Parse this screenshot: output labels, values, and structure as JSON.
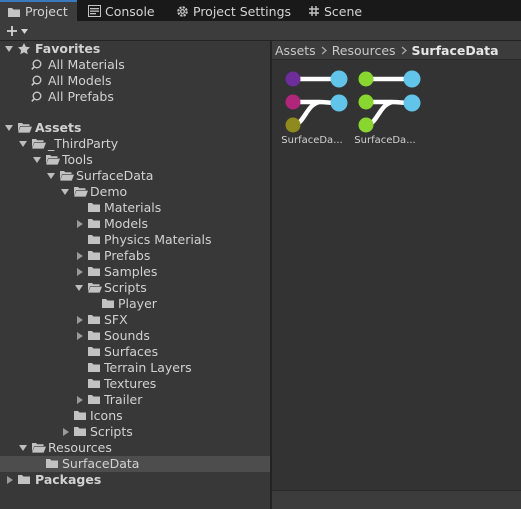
{
  "tabs": [
    {
      "label": "Project",
      "icon": "folder-icon",
      "active": true
    },
    {
      "label": "Console",
      "icon": "console-icon",
      "active": false
    },
    {
      "label": "Project Settings",
      "icon": "gear-icon",
      "active": false
    },
    {
      "label": "Scene",
      "icon": "hash-icon",
      "active": false
    }
  ],
  "toolbar": {
    "add_icon": "plus-icon",
    "dropdown_icon": "chevron-down-icon"
  },
  "tree": {
    "favorites": {
      "label": "Favorites",
      "items": [
        "All Materials",
        "All Models",
        "All Prefabs"
      ]
    },
    "assets": {
      "label": "Assets",
      "third_party": "_ThirdParty",
      "tools": "Tools",
      "surface_data": "SurfaceData",
      "demo": "Demo",
      "demo_children": [
        "Materials",
        "Models",
        "Physics Materials",
        "Prefabs",
        "Samples",
        "Scripts",
        "Player",
        "SFX",
        "Sounds",
        "Surfaces",
        "Terrain Layers",
        "Textures",
        "Trailer"
      ],
      "icons": "Icons",
      "scripts": "Scripts",
      "resources": "Resources",
      "resources_surface_data": "SurfaceData"
    },
    "packages": {
      "label": "Packages"
    }
  },
  "breadcrumb": {
    "items": [
      "Assets",
      "Resources",
      "SurfaceData"
    ]
  },
  "assets_grid": [
    {
      "name": "SurfaceDa...",
      "colors": [
        "#6d2d9a",
        "#b0267a",
        "#8e8a1e",
        "#63c4ea"
      ]
    },
    {
      "name": "SurfaceDa...",
      "colors": [
        "#8ad631",
        "#8ad631",
        "#8ad631",
        "#63c4ea"
      ]
    }
  ],
  "colors": {
    "accent": "#3a79bb",
    "panel": "#383838",
    "selected_row": "#4d4d4d"
  }
}
